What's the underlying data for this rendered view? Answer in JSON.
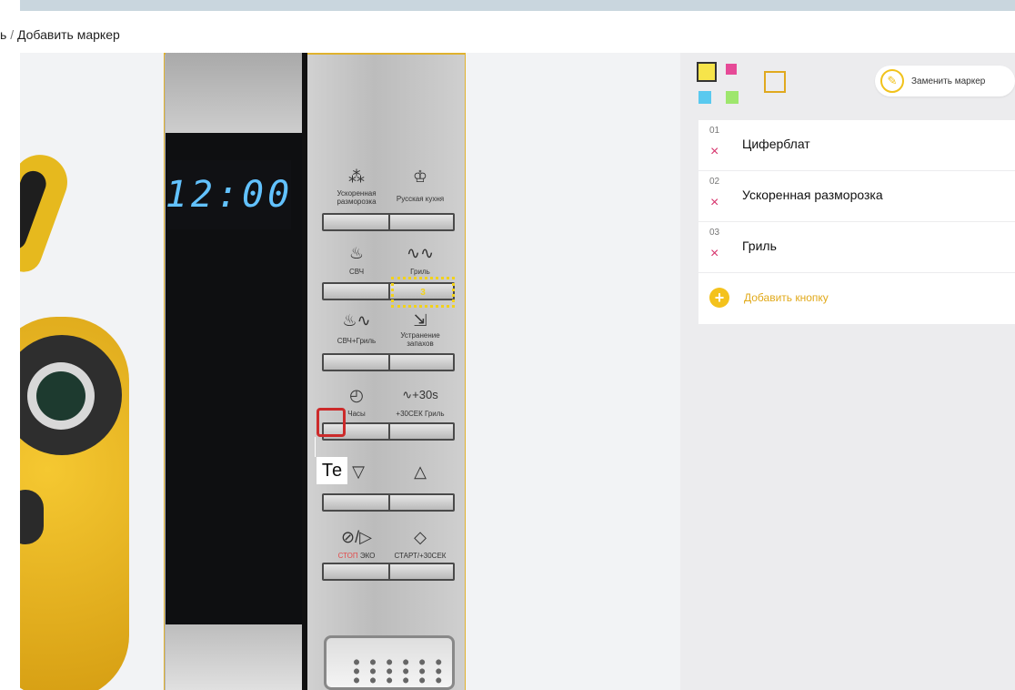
{
  "breadcrumb": {
    "prefix": "ь",
    "separator": "/",
    "current": "Добавить маркер"
  },
  "display": {
    "time": "12:00"
  },
  "microwave_buttons": [
    {
      "glyph": "⁂",
      "label": "Ускоренная разморозка"
    },
    {
      "glyph": "♔",
      "label": "Русская кухня"
    },
    {
      "glyph": "♨",
      "label": "СВЧ"
    },
    {
      "glyph": "∿∿",
      "label": "Гриль"
    },
    {
      "glyph": "♨∿",
      "label": "СВЧ+Гриль"
    },
    {
      "glyph": "⇲",
      "label": "Устранение запахов"
    },
    {
      "glyph": "◴",
      "label": "Часы"
    },
    {
      "glyph": "∿+30s",
      "label": "+30СЕК Гриль"
    },
    {
      "glyph": "▽",
      "label": ""
    },
    {
      "glyph": "△",
      "label": ""
    },
    {
      "glyph": "⊘/▷",
      "label_stop": "СТОП",
      "label": "ЭКО"
    },
    {
      "glyph": "◇",
      "label": "СТАРТ/+30СЕК"
    }
  ],
  "canvas_markers": {
    "marker_3_label": "3",
    "text_tool_value": "Те"
  },
  "toolbar": {
    "colors": {
      "yellow": "#f6e44a",
      "pink": "#e64a97",
      "cyan": "#59c9ef",
      "green": "#9ee66d",
      "accent": "#f1c21b"
    },
    "replace_marker_label": "Заменить маркер",
    "pencil_icon": "pencil-icon",
    "rect_icon": "rectangle-tool-icon"
  },
  "markers_list": [
    {
      "num": "01",
      "name": "Циферблат"
    },
    {
      "num": "02",
      "name": "Ускоренная разморозка"
    },
    {
      "num": "03",
      "name": "Гриль"
    }
  ],
  "add_button": {
    "label": "Добавить кнопку",
    "icon": "+"
  },
  "delete_glyph": "×"
}
